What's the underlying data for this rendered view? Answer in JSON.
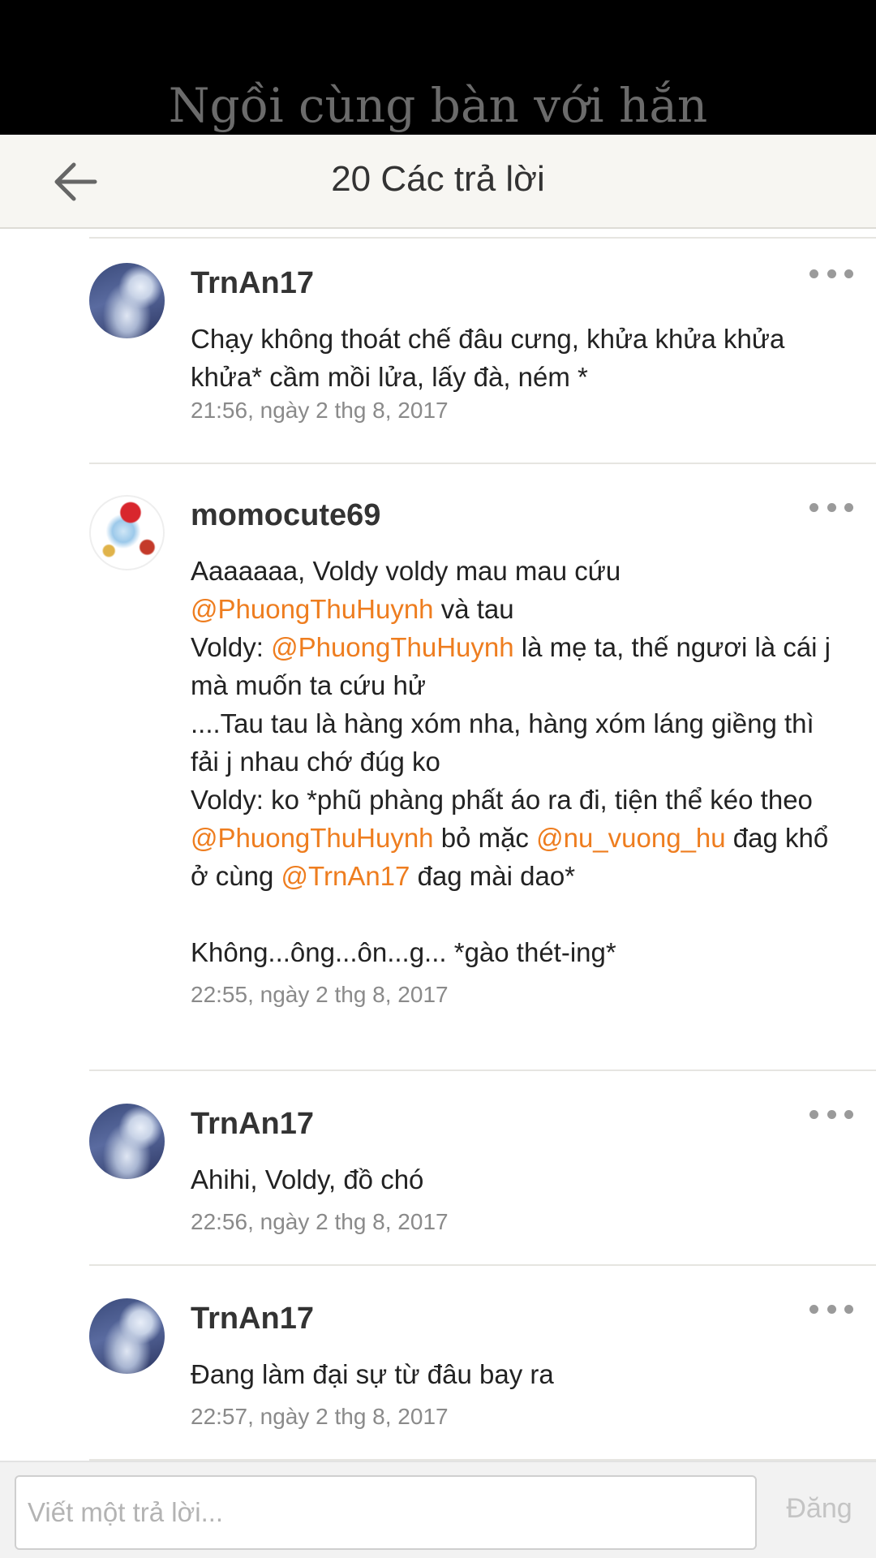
{
  "story": {
    "title": "Ngồi cùng bàn với hắn"
  },
  "header": {
    "back_icon": "arrow-left-icon",
    "title": "20 Các trả lời"
  },
  "comments": [
    {
      "avatar": "moon-girl-avatar",
      "username": "TrnAn17",
      "body_lines": [
        "Chạy không thoát chế đâu cưng, khửa khửa khửa",
        "khửa* cầm mồi lửa, lấy đà, ném *"
      ],
      "timestamp": "21:56, ngày 2 thg 8, 2017"
    },
    {
      "avatar": "chibi-christmas-avatar",
      "username": "momocute69",
      "body": {
        "l1": "Aaaaaaa, Voldy voldy mau mau cứu",
        "l2_mention": "@PhuongThuHuynh",
        "l2_text": " và tau",
        "l3_pre": "Voldy: ",
        "l3_mention": "@PhuongThuHuynh",
        "l3_text": " là mẹ ta, thế ngươi là cái j",
        "l4": "mà muốn ta cứu hử",
        "l5": "....Tau tau là hàng xóm nha, hàng xóm láng giềng thì",
        "l6": "fải j nhau chớ đúg ko",
        "l7": "Voldy: ko *phũ phàng phất áo ra đi, tiện thể kéo theo",
        "l8_mention1": "@PhuongThuHuynh",
        "l8_text1": " bỏ mặc ",
        "l8_mention2": "@nu_vuong_hu",
        "l8_text2": " đag khổ",
        "l9_pre": "ở cùng ",
        "l9_mention": "@TrnAn17",
        "l9_text": " đag mài dao*",
        "l11": "Không...ông...ôn...g... *gào thét-ing*"
      },
      "timestamp": "22:55, ngày 2 thg 8, 2017"
    },
    {
      "avatar": "moon-girl-avatar",
      "username": "TrnAn17",
      "body_lines": [
        "Ahihi, Voldy, đồ chó"
      ],
      "timestamp": "22:56, ngày 2 thg 8, 2017"
    },
    {
      "avatar": "moon-girl-avatar",
      "username": "TrnAn17",
      "body_lines": [
        "Đang làm đại sự từ đâu bay ra"
      ],
      "timestamp": "22:57, ngày 2 thg 8, 2017"
    }
  ],
  "more_icon": "more-horizontal-icon",
  "reply": {
    "placeholder": "Viết một trả lời...",
    "value": "",
    "post_label": "Đăng"
  },
  "colors": {
    "mention": "#ee7d1f",
    "header_bg": "#f7f6f2",
    "story_bar": "#000000"
  }
}
